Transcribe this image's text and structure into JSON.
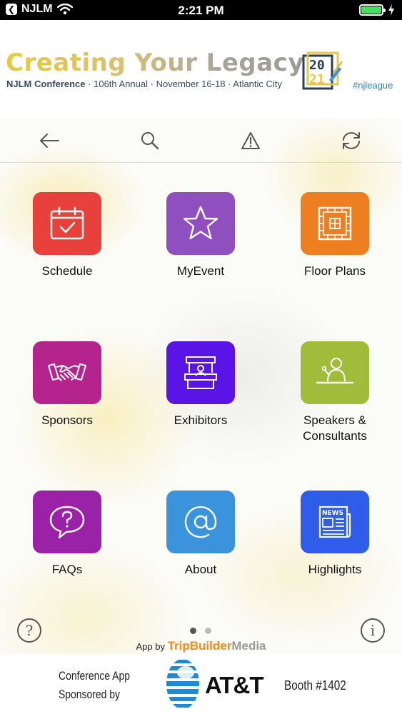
{
  "status_bar": {
    "back_app": "NJLM",
    "time": "2:21 PM"
  },
  "banner": {
    "title": "Creating Your Legacy",
    "subtitle_org": "NJLM Conference",
    "subtitle_annual": "106th Annual",
    "subtitle_dates": "November 16-18",
    "subtitle_city": "Atlantic City",
    "year_top": "20",
    "year_bottom": "21",
    "hashtag": "#njleague"
  },
  "toolbar": {
    "back_icon": "back-arrow-icon",
    "search_icon": "search-icon",
    "alert_icon": "warning-icon",
    "sync_icon": "sync-icon"
  },
  "tiles": [
    {
      "label": "Schedule",
      "icon": "calendar-check-icon",
      "color": "#e8403a"
    },
    {
      "label": "MyEvent",
      "icon": "star-icon",
      "color": "#8f4fbf"
    },
    {
      "label": "Floor Plans",
      "icon": "floor-plan-icon",
      "color": "#ee7f21"
    },
    {
      "label": "Sponsors",
      "icon": "handshake-icon",
      "color": "#b5238c"
    },
    {
      "label": "Exhibitors",
      "icon": "exhibitor-booth-icon",
      "color": "#5a14e6"
    },
    {
      "label": "Speakers &\nConsultants",
      "label_line1": "Speakers &",
      "label_line2": "Consultants",
      "icon": "speaker-podium-icon",
      "color": "#9fbd3a"
    },
    {
      "label": "FAQs",
      "icon": "question-bubble-icon",
      "color": "#9a22a6"
    },
    {
      "label": "About",
      "icon": "at-sign-icon",
      "color": "#3a93db"
    },
    {
      "label": "Highlights",
      "icon": "news-icon",
      "color": "#2f5ce8"
    }
  ],
  "footer_controls": {
    "help": "?",
    "info": "i",
    "page_count": 2,
    "active_page": 1,
    "app_by": "App by",
    "brand_part1": "TripBuilder",
    "brand_part2": "Media"
  },
  "sponsor": {
    "line1": "Conference App",
    "line2": "Sponsored by",
    "company": "AT&T",
    "booth": "Booth #1402"
  }
}
